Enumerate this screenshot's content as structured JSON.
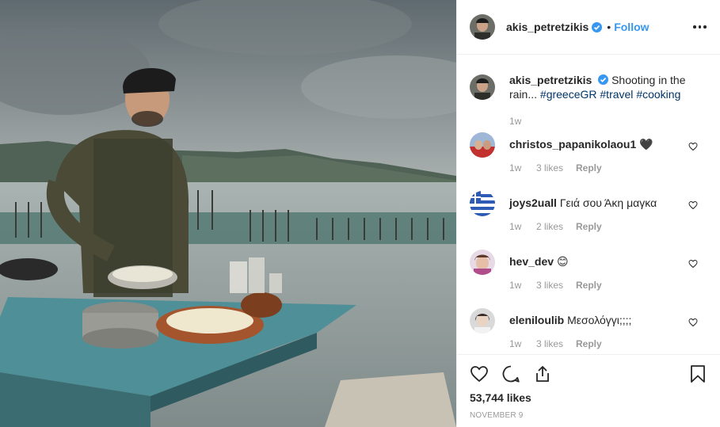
{
  "post": {
    "username": "akis_petretzikis",
    "follow_label": "Follow",
    "dot": "•",
    "caption_text": "Shooting in the rain... ",
    "hashtags": [
      "#greeceGR",
      "#travel",
      "#cooking"
    ],
    "caption_time": "1w",
    "likes_count": "53,744 likes",
    "date": "NOVEMBER 9"
  },
  "comments": [
    {
      "username": "christos_papanikolaou1",
      "text": "🖤",
      "time": "1w",
      "likes": "3 likes",
      "reply_label": "Reply"
    },
    {
      "username": "joys2uall",
      "text": "Γειά σου Άκη μαγκα",
      "time": "1w",
      "likes": "2 likes",
      "reply_label": "Reply"
    },
    {
      "username": "hev_dev",
      "text": "😊",
      "time": "1w",
      "likes": "3 likes",
      "reply_label": "Reply"
    },
    {
      "username": "eleniloulib",
      "text": "Μεσολόγγι;;;;",
      "time": "1w",
      "likes": "3 likes",
      "reply_label": "Reply"
    }
  ],
  "colors": {
    "link": "#3897f0",
    "hashtag": "#003569",
    "muted": "#999999",
    "verified": "#3897f0"
  },
  "icons": [
    "verified-badge-icon",
    "more-options-icon",
    "heart-icon",
    "comment-icon",
    "share-icon",
    "bookmark-icon"
  ]
}
